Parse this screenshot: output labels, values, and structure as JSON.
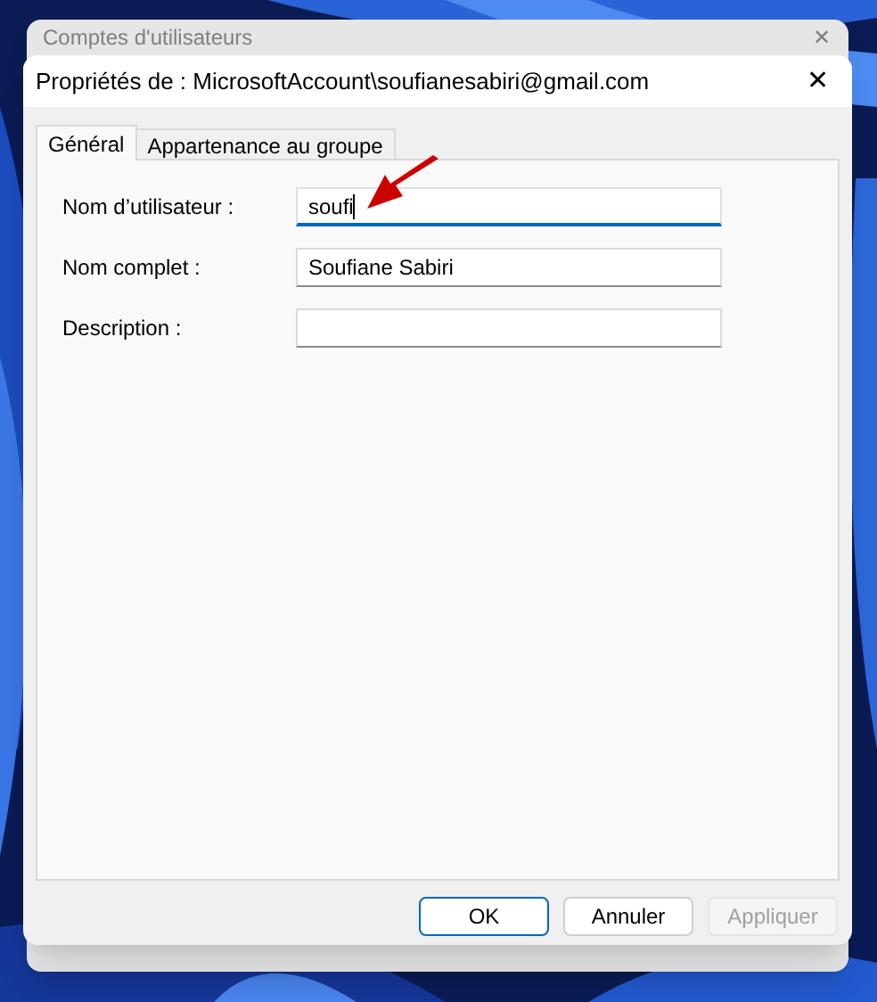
{
  "background_window": {
    "title": "Comptes d'utilisateurs",
    "close": "✕"
  },
  "dialog": {
    "title": "Propriétés de : MicrosoftAccount\\soufianesabiri@gmail.com",
    "close": "✕"
  },
  "tabs": [
    {
      "label": "Général",
      "selected": true
    },
    {
      "label": "Appartenance au groupe",
      "selected": false
    }
  ],
  "fields": [
    {
      "label": "Nom d’utilisateur :",
      "value": "soufi",
      "focused": true
    },
    {
      "label": "Nom complet :",
      "value": "Soufiane Sabiri",
      "focused": false
    },
    {
      "label": "Description :",
      "focused": false
    }
  ],
  "buttons": [
    {
      "label": "OK",
      "default": true,
      "disabled": false
    },
    {
      "label": "Annuler",
      "default": false,
      "disabled": false
    },
    {
      "label": "Appliquer",
      "default": false,
      "disabled": true
    }
  ]
}
